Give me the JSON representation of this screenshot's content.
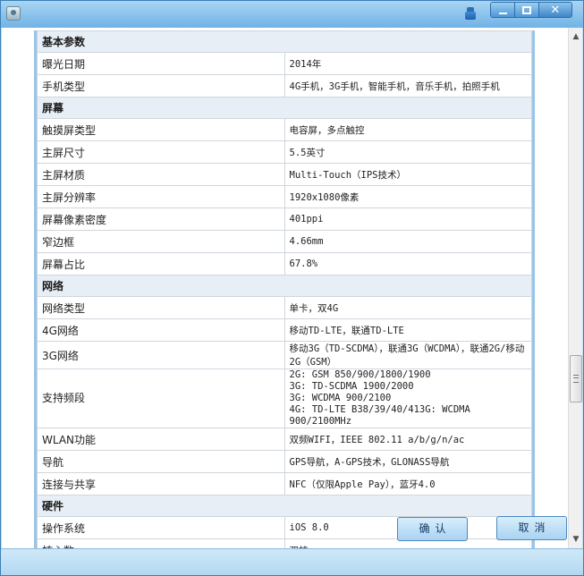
{
  "window": {
    "controls": {
      "minimize_icon": "minimize-icon",
      "maximize_icon": "maximize-icon",
      "close_icon": "close-icon"
    }
  },
  "sections": [
    {
      "title": "基本参数",
      "rows": [
        {
          "label": "曝光日期",
          "value": "2014年"
        },
        {
          "label": "手机类型",
          "value": "4G手机，3G手机，智能手机，音乐手机，拍照手机"
        }
      ]
    },
    {
      "title": "屏幕",
      "rows": [
        {
          "label": "触摸屏类型",
          "value": "电容屏，多点触控"
        },
        {
          "label": "主屏尺寸",
          "value": "5.5英寸"
        },
        {
          "label": "主屏材质",
          "value": "Multi-Touch（IPS技术）"
        },
        {
          "label": "主屏分辨率",
          "value": "1920x1080像素"
        },
        {
          "label": "屏幕像素密度",
          "value": "401ppi"
        },
        {
          "label": "窄边框",
          "value": "4.66mm"
        },
        {
          "label": "屏幕占比",
          "value": "67.8%"
        }
      ]
    },
    {
      "title": "网络",
      "rows": [
        {
          "label": "网络类型",
          "value": "单卡，双4G"
        },
        {
          "label": "4G网络",
          "value": "移动TD-LTE，联通TD-LTE"
        },
        {
          "label": "3G网络",
          "value": "移动3G（TD-SCDMA），联通3G（WCDMA），联通2G/移动2G（GSM）"
        },
        {
          "label": "支持频段",
          "lines": [
            "2G: GSM 850/900/1800/1900",
            "3G: TD-SCDMA 1900/2000",
            "3G: WCDMA 900/2100",
            "4G: TD-LTE B38/39/40/413G: WCDMA 900/2100MHz"
          ]
        },
        {
          "label": "WLAN功能",
          "value": "双频WIFI，IEEE 802.11 a/b/g/n/ac"
        },
        {
          "label": "导航",
          "value": "GPS导航，A-GPS技术，GLONASS导航"
        },
        {
          "label": "连接与共享",
          "value": "NFC（仅限Apple Pay），蓝牙4.0"
        }
      ]
    },
    {
      "title": "硬件",
      "rows": [
        {
          "label": "操作系统",
          "value": "iOS 8.0"
        },
        {
          "label": "核心数",
          "value": "双核"
        }
      ]
    }
  ],
  "buttons": {
    "ok": "确认",
    "cancel": "取消"
  }
}
